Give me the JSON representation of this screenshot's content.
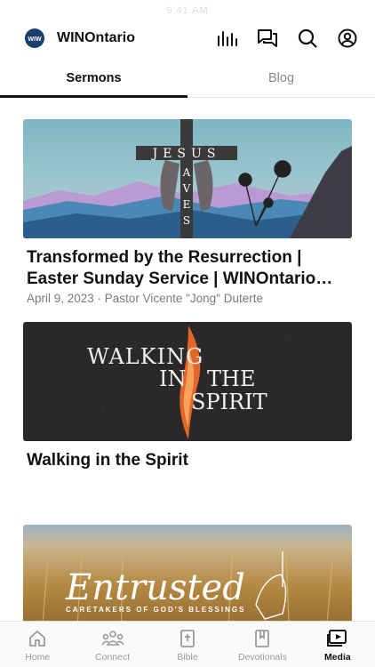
{
  "status_text": "9:41 AM",
  "header": {
    "app_name": "WINOntario",
    "logo_text": "WIW"
  },
  "tabs": [
    {
      "label": "Sermons",
      "active": true
    },
    {
      "label": "Blog",
      "active": false
    }
  ],
  "media": [
    {
      "title": "Transformed by the Resurrection | Easter Sunday Service | WINOntario Church",
      "meta": "April 9, 2023 · Pastor Vicente \"Jong\" Duterte",
      "art_text": [
        "JESUS",
        "SAVES"
      ]
    },
    {
      "title": "Walking in the Spirit",
      "meta": "",
      "art_text": [
        "WALKING",
        "IN",
        "THE",
        "SPIRIT"
      ]
    },
    {
      "title": "Entrusted",
      "meta": "",
      "art_text": [
        "Entrusted",
        "CARETAKERS OF GOD'S BLESSINGS"
      ]
    }
  ],
  "bottom_nav": [
    {
      "label": "Home",
      "icon": "home-icon"
    },
    {
      "label": "Connect",
      "icon": "connect-icon"
    },
    {
      "label": "Bible",
      "icon": "bible-icon"
    },
    {
      "label": "Devotionals",
      "icon": "devotionals-icon"
    },
    {
      "label": "Media",
      "icon": "media-icon",
      "active": true
    }
  ],
  "colors": {
    "accent": "#111111",
    "inactive": "#9a9a9a",
    "logo": "#1a3f6f"
  }
}
